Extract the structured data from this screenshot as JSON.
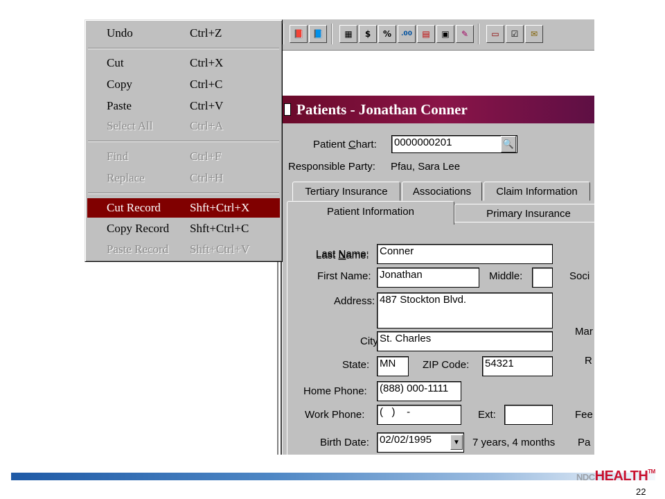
{
  "edit_menu": {
    "items": [
      {
        "label": "Undo",
        "shortcut": "Ctrl+Z",
        "state": "enabled"
      },
      {
        "label": "Cut",
        "shortcut": "Ctrl+X",
        "state": "enabled"
      },
      {
        "label": "Copy",
        "shortcut": "Ctrl+C",
        "state": "enabled"
      },
      {
        "label": "Paste",
        "shortcut": "Ctrl+V",
        "state": "enabled"
      },
      {
        "label": "Select All",
        "shortcut": "Ctrl+A",
        "state": "disabled"
      },
      {
        "label": "Find",
        "shortcut": "Ctrl+F",
        "state": "disabled"
      },
      {
        "label": "Replace",
        "shortcut": "Ctrl+H",
        "state": "disabled"
      },
      {
        "label": "Cut Record",
        "shortcut": "Shft+Ctrl+X",
        "state": "highlighted"
      },
      {
        "label": "Copy Record",
        "shortcut": "Shft+Ctrl+C",
        "state": "enabled"
      },
      {
        "label": "Paste Record",
        "shortcut": "Shft+Ctrl+V",
        "state": "disabled"
      }
    ],
    "highlight_color": "#800000"
  },
  "toolbar": {
    "buttons": [
      {
        "icon": "book-icon",
        "glyph": "📕"
      },
      {
        "icon": "book-arrow-icon",
        "glyph": "📘"
      },
      {
        "icon": "grid-icon",
        "glyph": "▦"
      },
      {
        "icon": "ledger-dollar-icon",
        "glyph": "$"
      },
      {
        "icon": "percent-icon",
        "glyph": "%"
      },
      {
        "icon": "decimal-icon",
        "glyph": ".00"
      },
      {
        "icon": "red-book-icon",
        "glyph": "▤"
      },
      {
        "icon": "forms-icon",
        "glyph": "▣"
      },
      {
        "icon": "edit-note-icon",
        "glyph": "✎"
      },
      {
        "icon": "chart-card-icon",
        "glyph": "▭"
      },
      {
        "icon": "checklist-icon",
        "glyph": "☑"
      },
      {
        "icon": "scroll-icon",
        "glyph": "✉"
      }
    ]
  },
  "window": {
    "title": "Patients - Jonathan Conner",
    "title_gradient": [
      "#6a0a2a",
      "#8a1448"
    ]
  },
  "patient": {
    "chart_label": "Patient Chart:",
    "chart_value": "0000000201",
    "responsible_label": "Responsible Party:",
    "responsible_value": "Pfau, Sara Lee"
  },
  "tabs": {
    "row1": [
      "Tertiary Insurance",
      "Associations",
      "Claim Information"
    ],
    "row2": [
      "Patient Information",
      "Primary Insurance"
    ],
    "active": "Patient Information"
  },
  "form": {
    "last_name_label": "Last Name:",
    "last_name": "Conner",
    "first_name_label": "First Name:",
    "first_name": "Jonathan",
    "middle_label": "Middle:",
    "middle": "",
    "address_label": "Address:",
    "address": "487 Stockton Blvd.",
    "city_label": "City:",
    "city": "St. Charles",
    "state_label": "State:",
    "state": "MN",
    "zip_label": "ZIP Code:",
    "zip": "54321",
    "home_phone_label": "Home Phone:",
    "home_phone": "(888) 000-1111",
    "work_phone_label": "Work Phone:",
    "work_phone": "(   )    -",
    "ext_label": "Ext:",
    "ext": "",
    "birth_date_label": "Birth Date:",
    "birth_date": "02/02/1995",
    "age": "7 years, 4 months",
    "right_clipped": [
      "Soci",
      "Mar",
      "R",
      "Fee",
      "Pa"
    ]
  },
  "footer": {
    "logo_prefix": "NDC",
    "logo_main": "HEALTH",
    "logo_tm": "TM",
    "page_number": "22"
  }
}
